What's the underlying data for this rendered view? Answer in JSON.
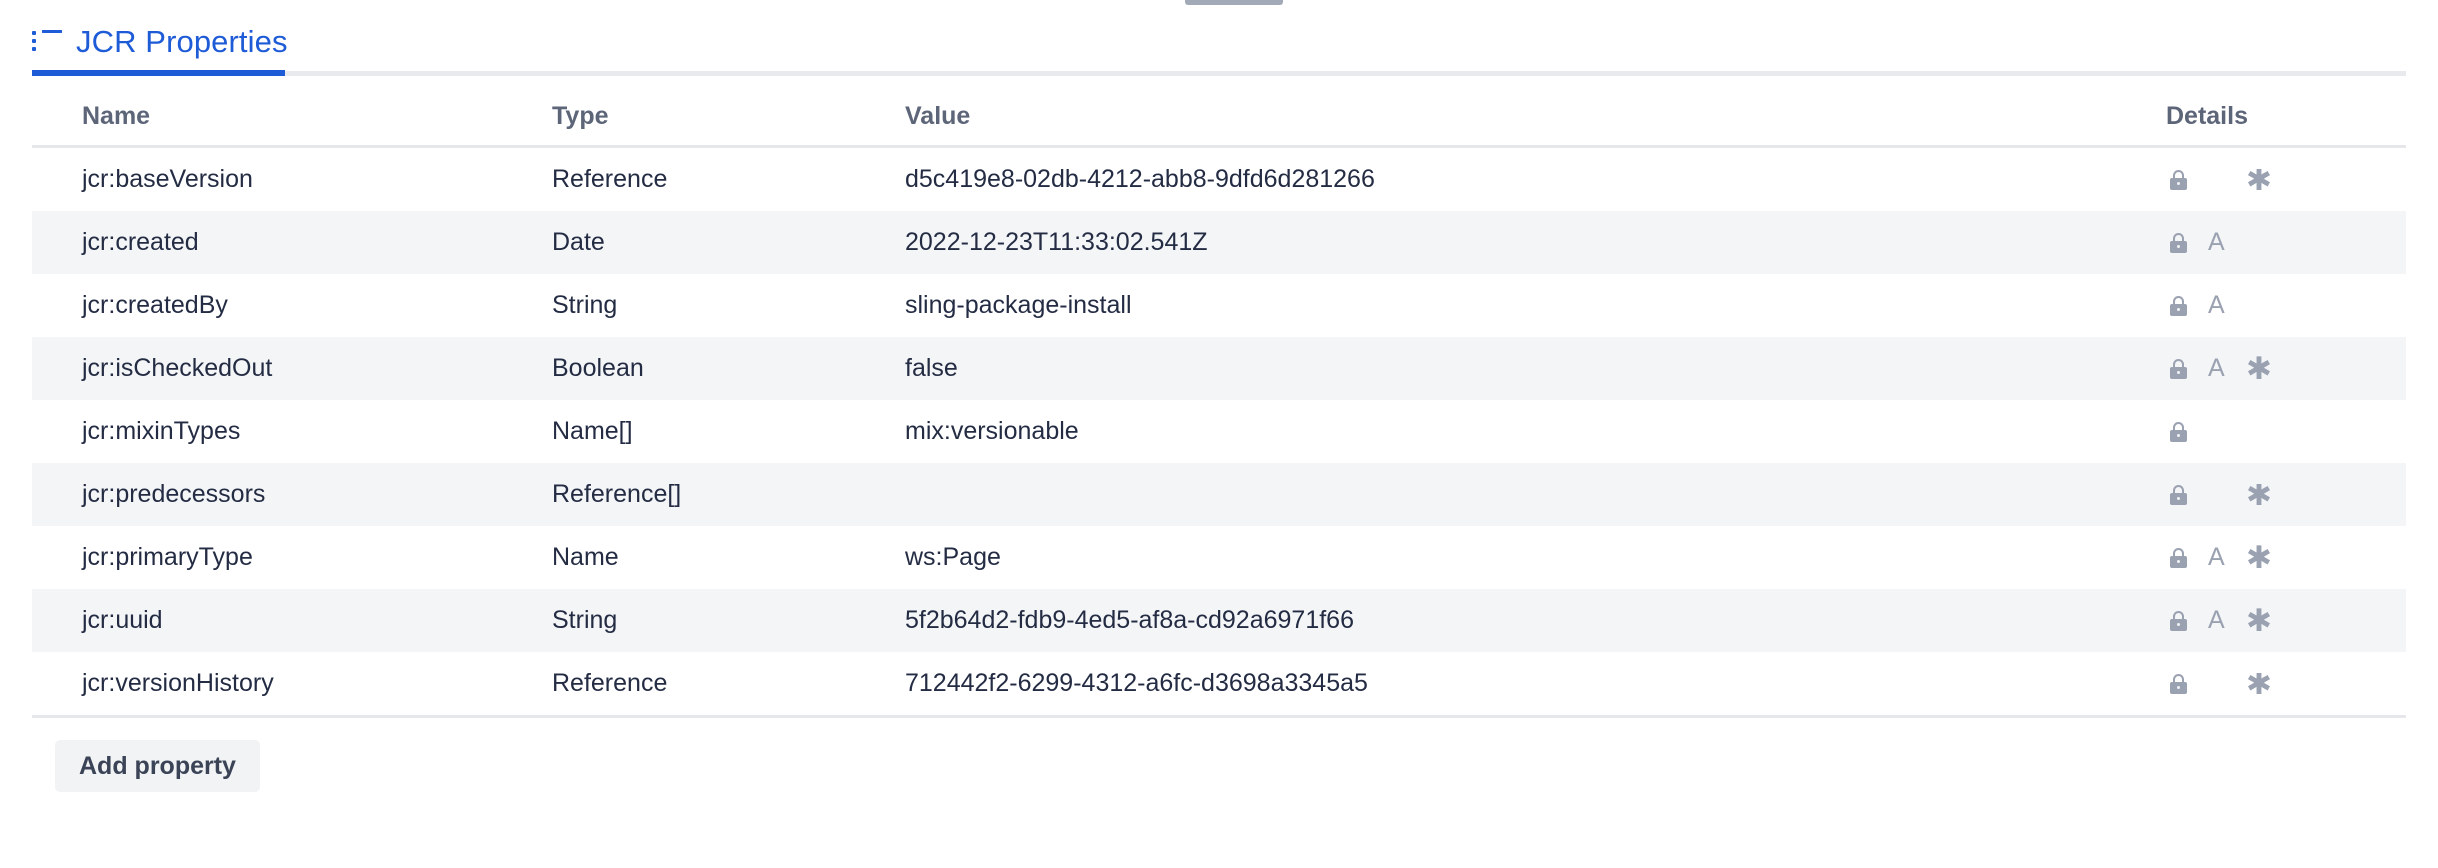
{
  "tab": {
    "label": "JCR Properties",
    "icon": "list-icon",
    "active_color": "#1e5bd6"
  },
  "table": {
    "columns": [
      "Name",
      "Type",
      "Value",
      "Details"
    ],
    "rows": [
      {
        "name": "jcr:baseVersion",
        "type": "Reference",
        "value": "d5c419e8-02db-4212-abb8-9dfd6d281266",
        "marked": true,
        "details": {
          "lock": true,
          "protected_a": false,
          "asterisk": true
        }
      },
      {
        "name": "jcr:created",
        "type": "Date",
        "value": "2022-12-23T11:33:02.541Z",
        "marked": false,
        "details": {
          "lock": true,
          "protected_a": true,
          "asterisk": false
        }
      },
      {
        "name": "jcr:createdBy",
        "type": "String",
        "value": "sling-package-install",
        "marked": false,
        "details": {
          "lock": true,
          "protected_a": true,
          "asterisk": false
        }
      },
      {
        "name": "jcr:isCheckedOut",
        "type": "Boolean",
        "value": "false",
        "marked": true,
        "details": {
          "lock": true,
          "protected_a": true,
          "asterisk": true
        }
      },
      {
        "name": "jcr:mixinTypes",
        "type": "Name[]",
        "value": "mix:versionable",
        "marked": false,
        "details": {
          "lock": true,
          "protected_a": false,
          "asterisk": false
        }
      },
      {
        "name": "jcr:predecessors",
        "type": "Reference[]",
        "value": "",
        "marked": true,
        "details": {
          "lock": true,
          "protected_a": false,
          "asterisk": true
        }
      },
      {
        "name": "jcr:primaryType",
        "type": "Name",
        "value": "ws:Page",
        "marked": false,
        "details": {
          "lock": true,
          "protected_a": true,
          "asterisk": true
        }
      },
      {
        "name": "jcr:uuid",
        "type": "String",
        "value": "5f2b64d2-fdb9-4ed5-af8a-cd92a6971f66",
        "marked": false,
        "details": {
          "lock": true,
          "protected_a": true,
          "asterisk": true
        }
      },
      {
        "name": "jcr:versionHistory",
        "type": "Reference",
        "value": "712442f2-6299-4312-a6fc-d3698a3345a5",
        "marked": true,
        "details": {
          "lock": true,
          "protected_a": false,
          "asterisk": true
        }
      }
    ]
  },
  "actions": {
    "add_property_label": "Add property"
  },
  "icons": {
    "lock": "lock-icon",
    "attribute_a": "A",
    "asterisk": "✱"
  }
}
